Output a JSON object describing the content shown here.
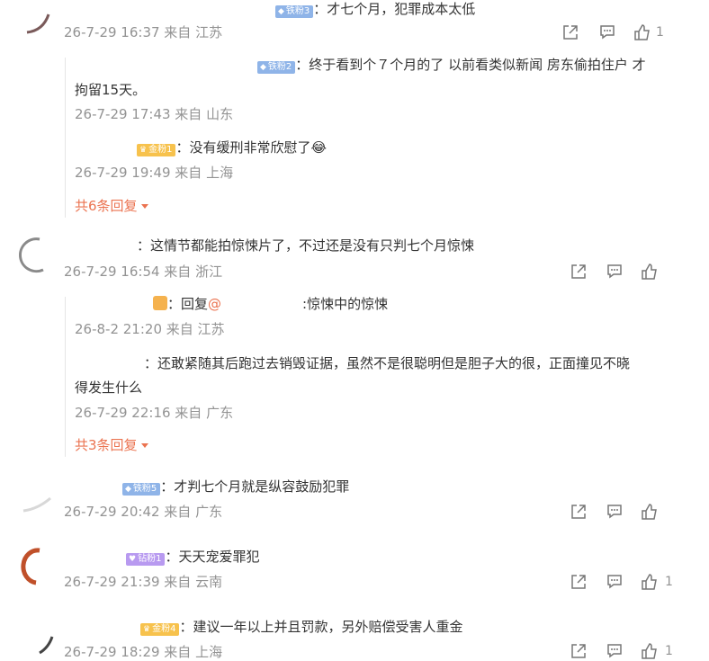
{
  "comments": [
    {
      "badge": "铁粉3",
      "text": "：才七个月，犯罪成本太低",
      "meta": "26-7-29 16:37 来自 江苏",
      "like_count": "1"
    },
    {
      "badge": "铁粉2",
      "text_line1": "：终于看到个７个月的了  以前看类似新闻 房东偷拍住户 才",
      "text_line2": "拘留15天。",
      "meta": "26-7-29 17:43 来自 山东"
    },
    {
      "badge": "金粉1",
      "text": "：没有缓刑非常欣慰了😂",
      "meta": "26-7-29 19:49 来自 上海",
      "more": "共6条回复"
    },
    {
      "text": "：这情节都能拍惊悚片了，不过还是没有只判七个月惊悚",
      "meta": "26-7-29 16:54 来自 浙江"
    },
    {
      "prefix": "：回复",
      "mention": "@",
      "suffix": ":惊悚中的惊悚",
      "meta": "26-8-2 21:20 来自 江苏"
    },
    {
      "text_line1": "：还敢紧随其后跑过去销毁证据，虽然不是很聪明但是胆子大的很，正面撞见不晓",
      "text_line2": "得发生什么",
      "meta": "26-7-29 22:16 来自 广东",
      "more": "共3条回复"
    },
    {
      "badge": "铁粉5",
      "text": "：才判七个月就是纵容鼓励犯罪",
      "meta": "26-7-29 20:42 来自 广东"
    },
    {
      "badge": "钻粉1",
      "text": "：天天宠爱罪犯",
      "meta": "26-7-29 21:39 来自 云南",
      "like_count": "1"
    },
    {
      "badge": "金粉4",
      "text": "：建议一年以上并且罚款，另外赔偿受害人重金",
      "meta": "26-7-29 18:29 来自 上海",
      "like_count": "1"
    }
  ],
  "colors": {
    "link": "#eb7350",
    "meta": "#939393",
    "text": "#333333"
  },
  "icons": [
    "share-icon",
    "comment-icon",
    "like-icon"
  ]
}
